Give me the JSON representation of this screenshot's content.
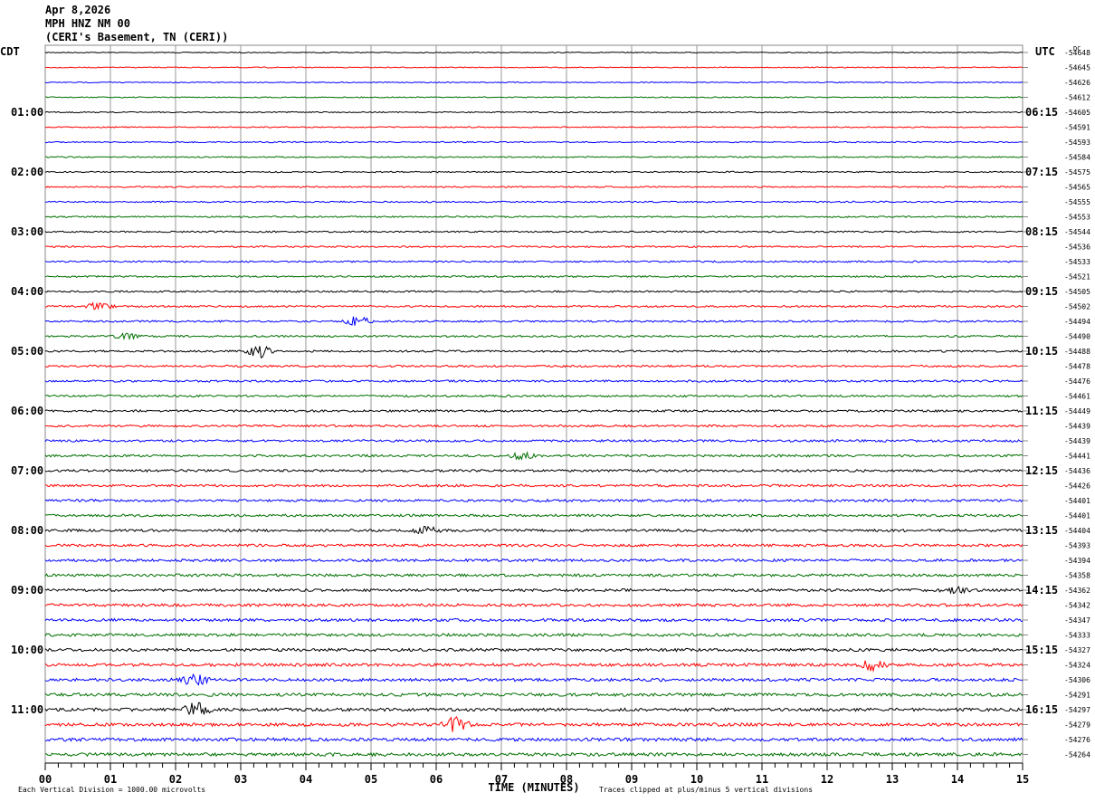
{
  "header": {
    "date": "Apr 8,2026",
    "station": "MPH HNZ NM 00",
    "location": "(CERI's Basement, TN (CERI))"
  },
  "chart_data": {
    "type": "line",
    "title": "Apr 8,2026",
    "xlabel": "TIME (MINUTES)",
    "xlim": [
      0,
      15
    ],
    "x_ticks": [
      "00",
      "01",
      "02",
      "03",
      "04",
      "05",
      "06",
      "07",
      "08",
      "09",
      "10",
      "11",
      "12",
      "13",
      "14",
      "15"
    ],
    "left_axis_label": "CDT",
    "right_axis_label": "UTC",
    "dc_label": "DC",
    "left_hour_labels": [
      "01:00",
      "02:00",
      "03:00",
      "04:00",
      "05:00",
      "06:00",
      "07:00",
      "08:00",
      "09:00",
      "10:00",
      "11:00"
    ],
    "right_hour_labels": [
      "06:15",
      "07:15",
      "08:15",
      "09:15",
      "10:15",
      "11:15",
      "12:15",
      "13:15",
      "14:15",
      "15:15",
      "16:15"
    ],
    "rows_per_hour": 4,
    "trace_colors": [
      "#000000",
      "#ff0000",
      "#0000ff",
      "#007000"
    ],
    "dc_offsets": [
      -54648,
      -54645,
      -54626,
      -54612,
      -54605,
      -54591,
      -54593,
      -54584,
      -54575,
      -54565,
      -54555,
      -54553,
      -54544,
      -54536,
      -54533,
      -54521,
      -54505,
      -54502,
      -54494,
      -54490,
      -54488,
      -54478,
      -54476,
      -54461,
      -54449,
      -54439,
      -54439,
      -54441,
      -54436,
      -54426,
      -54401,
      -54401,
      -54404,
      -54393,
      -54394,
      -54358,
      -54362,
      -54342,
      -54347,
      -54333,
      -54327,
      -54324,
      -54306,
      -54291,
      -54297,
      -54279,
      -54276,
      -54264
    ],
    "scale_note": "Each Vertical Division = 1000.00 microvolts",
    "clip_note": "Traces clipped at plus/minus 5 vertical divisions",
    "grid": true
  }
}
